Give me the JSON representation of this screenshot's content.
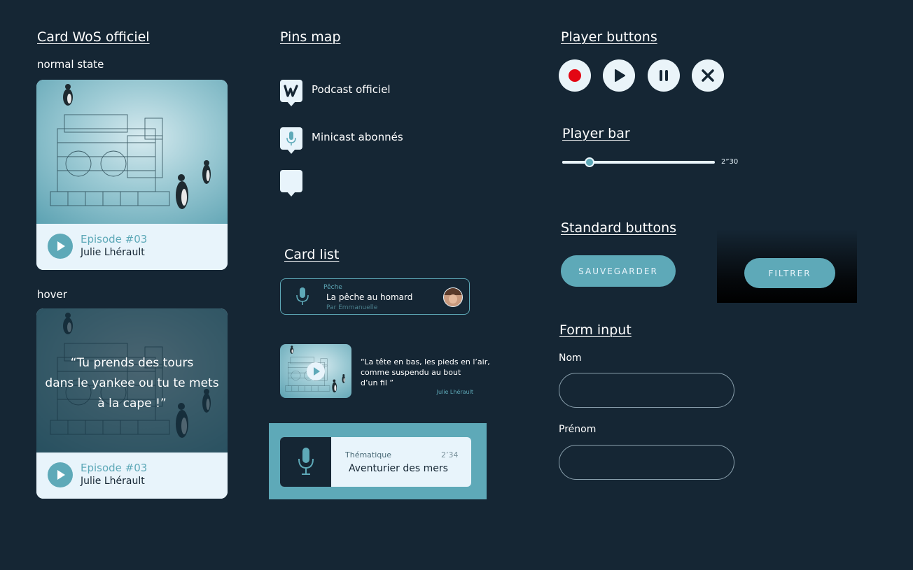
{
  "sections": {
    "card_wos": "Card WoS officiel",
    "pins_map": "Pins map",
    "card_list": "Card list",
    "player_buttons": "Player buttons",
    "player_bar": "Player bar",
    "standard_buttons": "Standard buttons",
    "form_input": "Form input"
  },
  "card_normal": {
    "state_label": "normal state",
    "episode": "Episode #03",
    "author": "Julie Lhérault"
  },
  "card_hover": {
    "state_label": "hover",
    "quote_line1": "“Tu prends des tours",
    "quote_line2": "dans le yankee ou tu te mets",
    "quote_line3": "à la cape !”",
    "episode": "Episode #03",
    "author": "Julie Lhérault"
  },
  "pins": [
    {
      "icon": "w-logo-icon",
      "label": "Podcast officiel"
    },
    {
      "icon": "microphone-icon",
      "label": "Minicast abonnés"
    },
    {
      "icon": "blank-pin-icon",
      "label": ""
    }
  ],
  "card_list_items": {
    "item1": {
      "category": "Pêche",
      "title": "La pêche au homard",
      "author": "Par Emmanuelle"
    },
    "item2": {
      "quote_line1": "“La tête en bas, les pieds en l’air,",
      "quote_line2": "comme suspendu au bout",
      "quote_line3": "d’un fil ”",
      "author": "Julie Lhérault"
    },
    "item3": {
      "theme_label": "Thématique",
      "duration": "2’34",
      "title": "Aventurier des mers"
    }
  },
  "player": {
    "buttons": [
      "record-icon",
      "play-icon",
      "pause-icon",
      "close-icon"
    ],
    "time": "2”30",
    "progress": 0.18
  },
  "standard_buttons": {
    "save": "SAUVEGARDER",
    "filter": "FILTRER"
  },
  "form": {
    "nom_label": "Nom",
    "prenom_label": "Prénom",
    "nom_value": "",
    "prenom_value": ""
  },
  "colors": {
    "background": "#152634",
    "accent": "#5ea9b8",
    "light": "#e8f4fb",
    "record": "#e30613"
  }
}
